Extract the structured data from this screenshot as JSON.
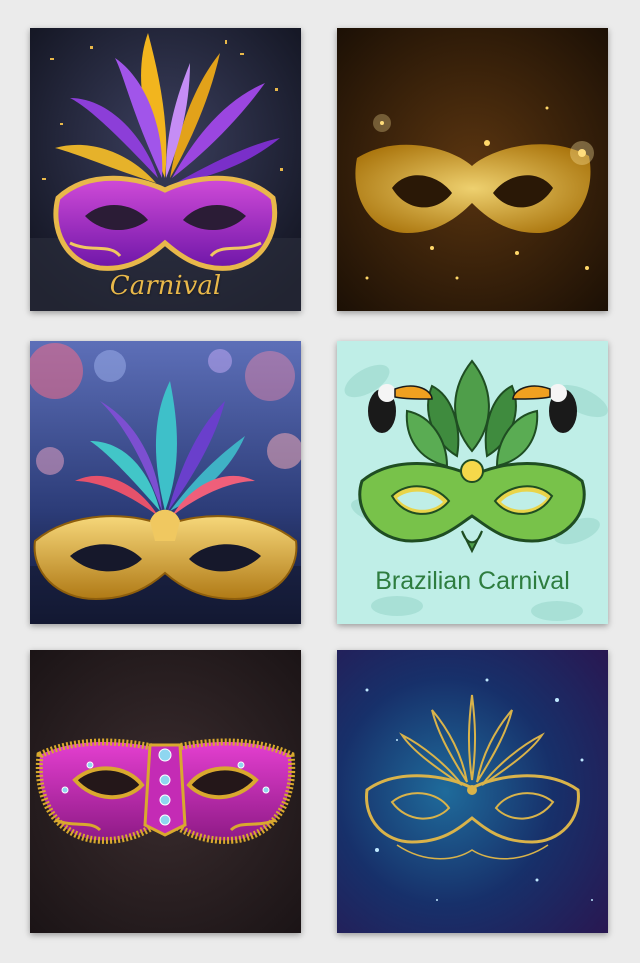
{
  "tiles": [
    {
      "id": "purple-gold-feather-mask",
      "caption": "Carnival"
    },
    {
      "id": "gold-glitter-mask",
      "caption": ""
    },
    {
      "id": "gold-mask-colorful-feathers",
      "caption": ""
    },
    {
      "id": "toucan-leaf-mask",
      "caption": "Brazilian Carnival"
    },
    {
      "id": "pink-glitter-jeweled-mask",
      "caption": ""
    },
    {
      "id": "filigree-gold-mask",
      "caption": ""
    }
  ],
  "colors": {
    "background": "#ebebeb",
    "gold": "#e8b84a",
    "purple": "#8a2bd6",
    "magenta": "#c21fb5",
    "green": "#2e7d3f",
    "mint": "#bfeee7"
  }
}
